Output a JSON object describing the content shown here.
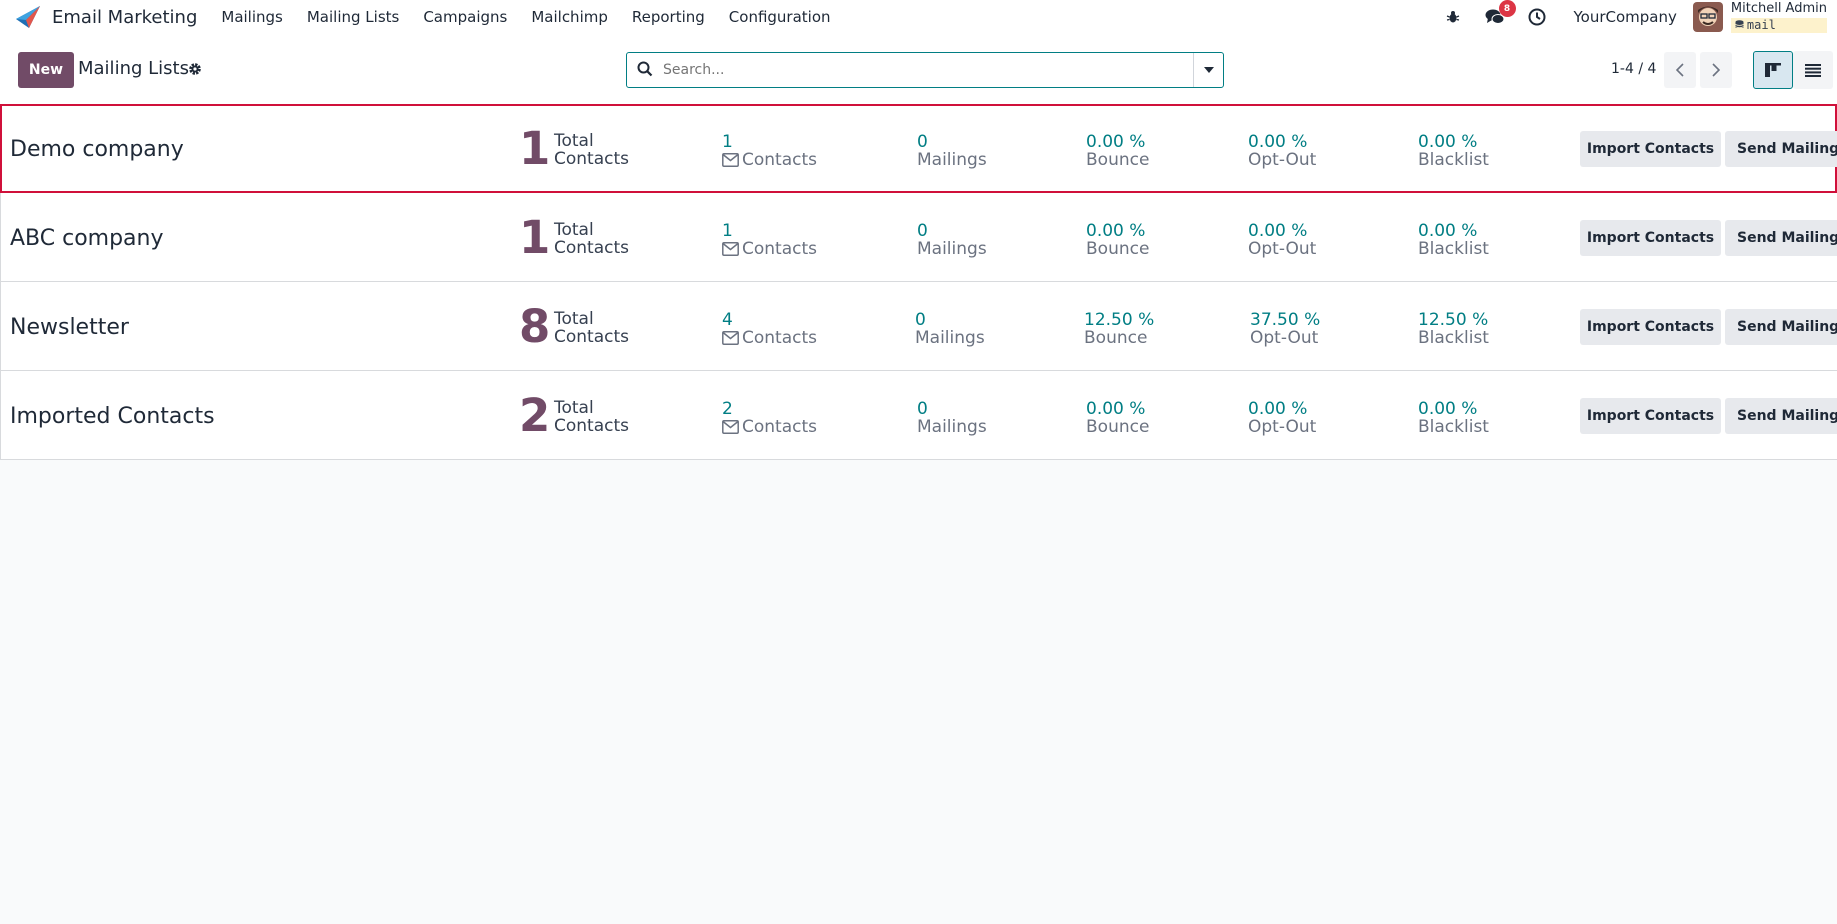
{
  "navbar": {
    "app_name": "Email Marketing",
    "menu": [
      "Mailings",
      "Mailing Lists",
      "Campaigns",
      "Mailchimp",
      "Reporting",
      "Configuration"
    ],
    "chat_badge": "8",
    "company": "YourCompany",
    "user_name": "Mitchell Admin",
    "db_name": "mail"
  },
  "control_panel": {
    "new_label": "New",
    "title": "Mailing Lists",
    "search_placeholder": "Search...",
    "pager": "1-4 / 4"
  },
  "labels": {
    "total": "Total",
    "contacts": "Contacts",
    "mailings": "Mailings",
    "bounce": "Bounce",
    "opt_out": "Opt-Out",
    "blacklist": "Blacklist",
    "import_button": "Import Contacts",
    "send_button": "Send Mailing"
  },
  "colors": {
    "brand": "#714b67",
    "accent": "#017e84",
    "selection": "#d0103a"
  },
  "rows": [
    {
      "name": "Demo company",
      "total": "1",
      "contacts": "1",
      "mailings": "0",
      "bounce": "0.00 %",
      "opt_out": "0.00 %",
      "blacklist": "0.00 %",
      "selected": true
    },
    {
      "name": "ABC company",
      "total": "1",
      "contacts": "1",
      "mailings": "0",
      "bounce": "0.00 %",
      "opt_out": "0.00 %",
      "blacklist": "0.00 %",
      "selected": false
    },
    {
      "name": "Newsletter",
      "total": "8",
      "contacts": "4",
      "mailings": "0",
      "bounce": "12.50 %",
      "opt_out": "37.50 %",
      "blacklist": "12.50 %",
      "selected": false
    },
    {
      "name": "Imported Contacts",
      "total": "2",
      "contacts": "2",
      "mailings": "0",
      "bounce": "0.00 %",
      "opt_out": "0.00 %",
      "blacklist": "0.00 %",
      "selected": false
    }
  ]
}
